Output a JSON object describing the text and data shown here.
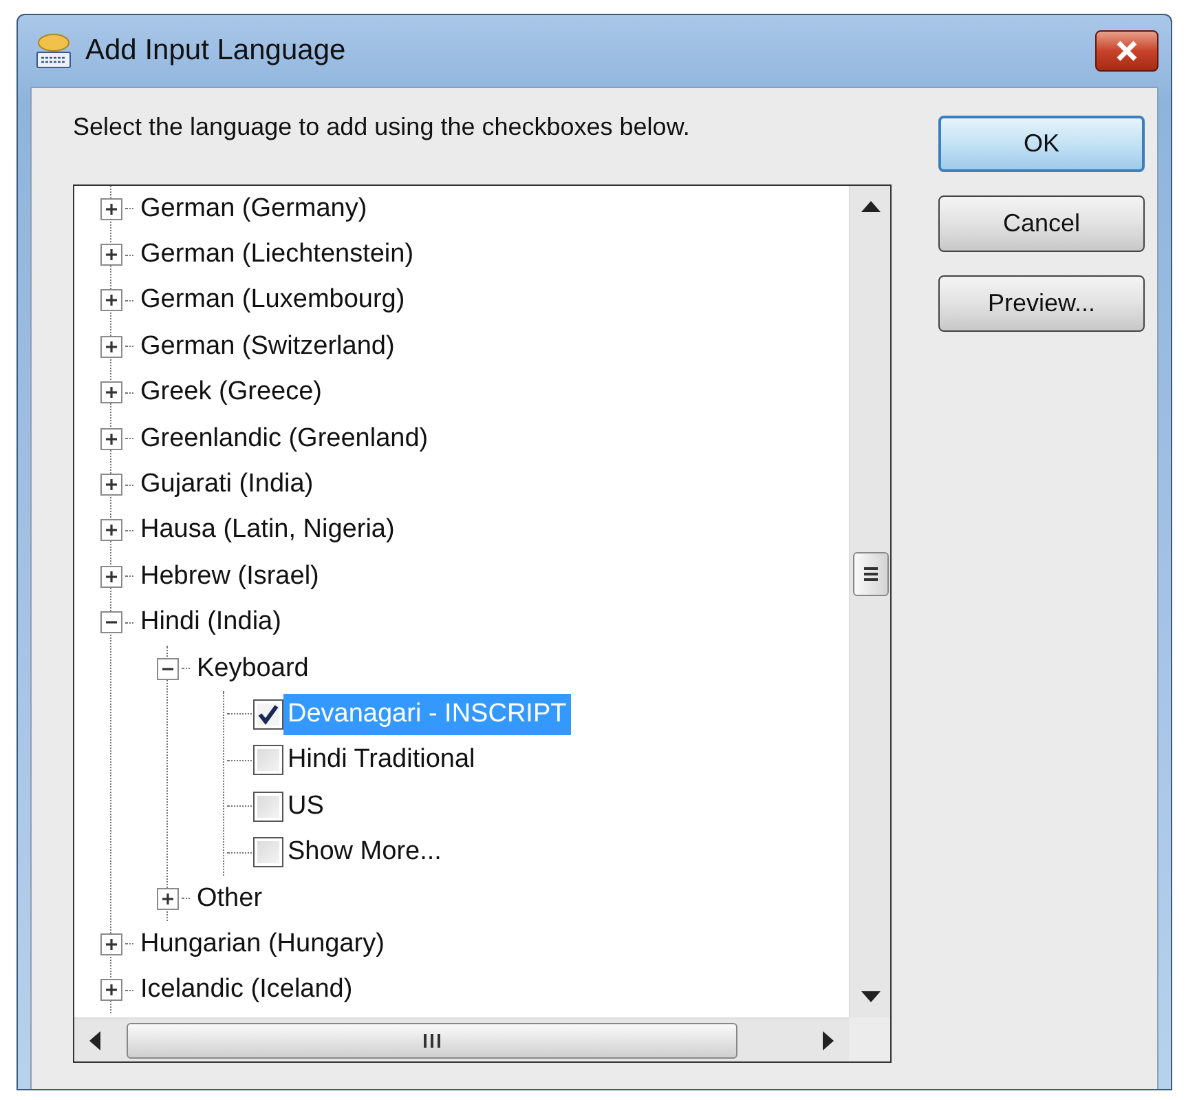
{
  "window": {
    "title": "Add Input Language"
  },
  "instruction": "Select the language to add using the checkboxes below.",
  "tree": {
    "items": [
      {
        "kind": "node",
        "label": "German (Germany)",
        "expanded": false
      },
      {
        "kind": "node",
        "label": "German (Liechtenstein)",
        "expanded": false
      },
      {
        "kind": "node",
        "label": "German (Luxembourg)",
        "expanded": false
      },
      {
        "kind": "node",
        "label": "German (Switzerland)",
        "expanded": false
      },
      {
        "kind": "node",
        "label": "Greek (Greece)",
        "expanded": false
      },
      {
        "kind": "node",
        "label": "Greenlandic (Greenland)",
        "expanded": false
      },
      {
        "kind": "node",
        "label": "Gujarati (India)",
        "expanded": false
      },
      {
        "kind": "node",
        "label": "Hausa (Latin, Nigeria)",
        "expanded": false
      },
      {
        "kind": "node",
        "label": "Hebrew (Israel)",
        "expanded": false
      },
      {
        "kind": "node",
        "label": "Hindi (India)",
        "expanded": true,
        "children": [
          {
            "kind": "node",
            "label": "Keyboard",
            "expanded": true,
            "children": [
              {
                "kind": "checkbox",
                "label": "Devanagari - INSCRIPT",
                "checked": true,
                "selected": true
              },
              {
                "kind": "checkbox",
                "label": "Hindi Traditional",
                "checked": false,
                "selected": false
              },
              {
                "kind": "checkbox",
                "label": "US",
                "checked": false,
                "selected": false
              },
              {
                "kind": "checkbox",
                "label": "Show More...",
                "checked": false,
                "selected": false
              }
            ]
          },
          {
            "kind": "node",
            "label": "Other",
            "expanded": false
          }
        ]
      },
      {
        "kind": "node",
        "label": "Hungarian (Hungary)",
        "expanded": false
      },
      {
        "kind": "node",
        "label": "Icelandic (Iceland)",
        "expanded": false
      }
    ]
  },
  "buttons": [
    {
      "label": "OK",
      "default": true
    },
    {
      "label": "Cancel",
      "default": false
    },
    {
      "label": "Preview...",
      "default": false
    }
  ]
}
